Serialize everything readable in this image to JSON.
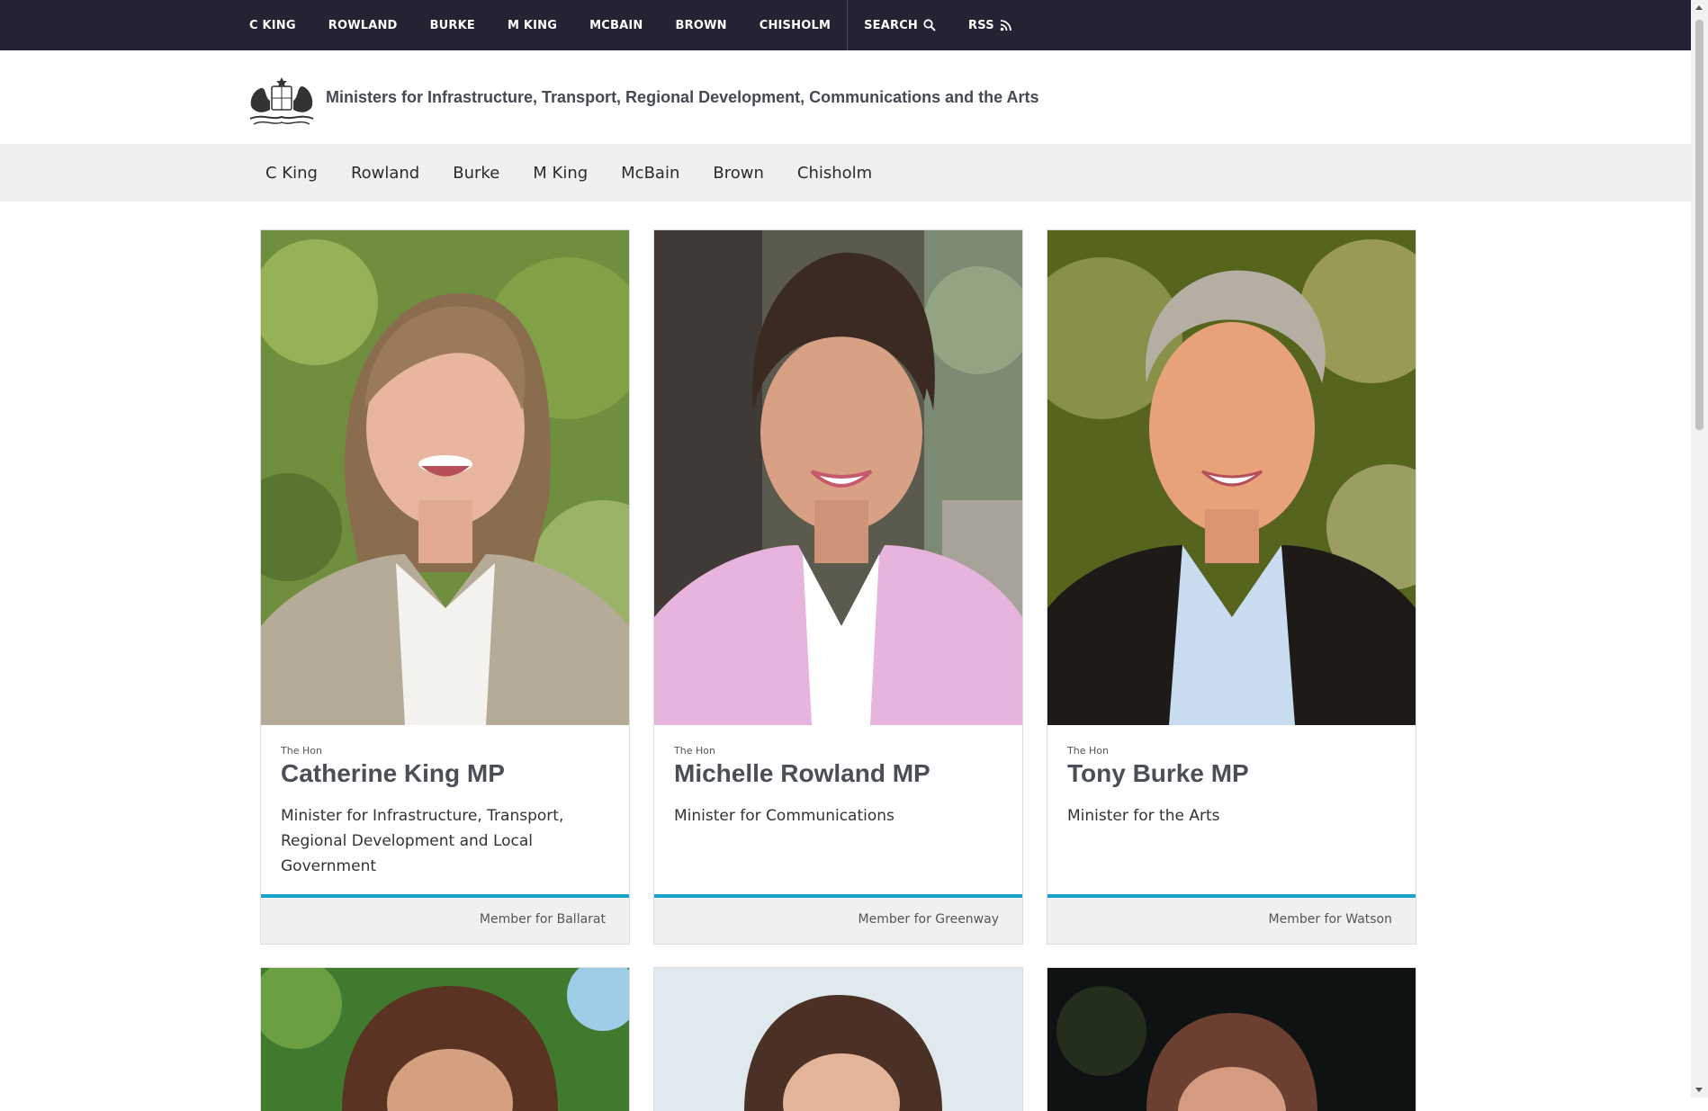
{
  "top_nav": {
    "items": [
      "C KING",
      "ROWLAND",
      "BURKE",
      "M KING",
      "MCBAIN",
      "BROWN",
      "CHISHOLM"
    ],
    "search_label": "SEARCH",
    "rss_label": "RSS"
  },
  "header": {
    "title": "Ministers for Infrastructure, Transport, Regional Development, Communications and the Arts"
  },
  "sub_nav": {
    "items": [
      "C King",
      "Rowland",
      "Burke",
      "M King",
      "McBain",
      "Brown",
      "Chisholm"
    ]
  },
  "cards": [
    {
      "honorific": "The Hon",
      "name": "Catherine King MP",
      "role": "Minister for Infrastructure, Transport, Regional Development and Local Government",
      "member": "Member for Ballarat"
    },
    {
      "honorific": "The Hon",
      "name": "Michelle Rowland MP",
      "role": "Minister for Communications",
      "member": "Member for Greenway"
    },
    {
      "honorific": "The Hon",
      "name": "Tony Burke MP",
      "role": "Minister for the Arts",
      "member": "Member for Watson"
    }
  ],
  "colors": {
    "top_bar": "#262233",
    "accent": "#1aa3c8",
    "sub_nav_bg": "#f0f0f0"
  }
}
